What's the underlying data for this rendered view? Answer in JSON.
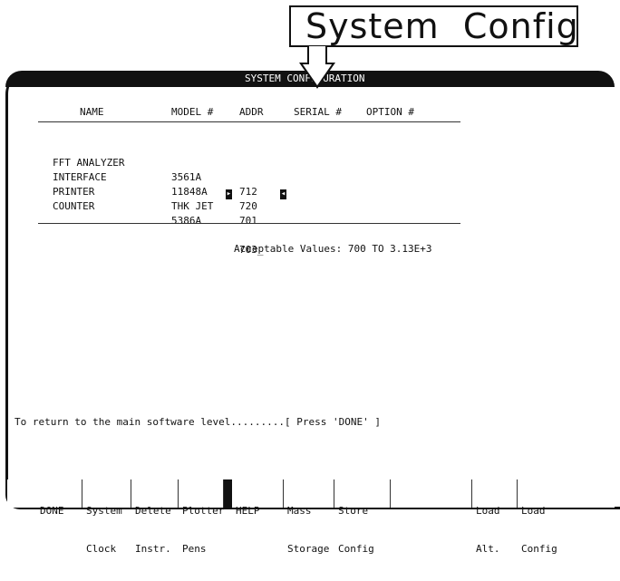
{
  "callout": {
    "label": "System  Config"
  },
  "title_bar": {
    "title": "SYSTEM CONFIGURATION"
  },
  "table": {
    "headers": [
      "NAME",
      "MODEL #",
      "ADDR",
      "SERIAL #",
      "OPTION #"
    ],
    "rows": [
      {
        "name": "FFT ANALYZER",
        "model": "3561A",
        "addr": "712"
      },
      {
        "name": "INTERFACE",
        "model": "11848A",
        "addr": "720"
      },
      {
        "name": "PRINTER",
        "model": "THK JET",
        "addr": "701"
      },
      {
        "name": "COUNTER",
        "model": "5386A",
        "addr": "703_"
      }
    ]
  },
  "acceptable": "Acceptable Values: 700 TO 3.13E+3",
  "return_msg": "To return to the main software level.........[ Press 'DONE' ]",
  "softkeys": [
    {
      "line1": "DONE",
      "line2": ""
    },
    {
      "line1": "System",
      "line2": "Clock"
    },
    {
      "line1": "Delete",
      "line2": "Instr."
    },
    {
      "line1": "Plotter",
      "line2": "Pens"
    },
    {
      "line1": "HELP",
      "line2": ""
    },
    {
      "line1": "Mass",
      "line2": "Storage"
    },
    {
      "line1": "Store",
      "line2": "Config"
    },
    {
      "line1": "",
      "line2": ""
    },
    {
      "line1": "Load",
      "line2": "Alt."
    },
    {
      "line1": "Load",
      "line2": "Config"
    }
  ]
}
